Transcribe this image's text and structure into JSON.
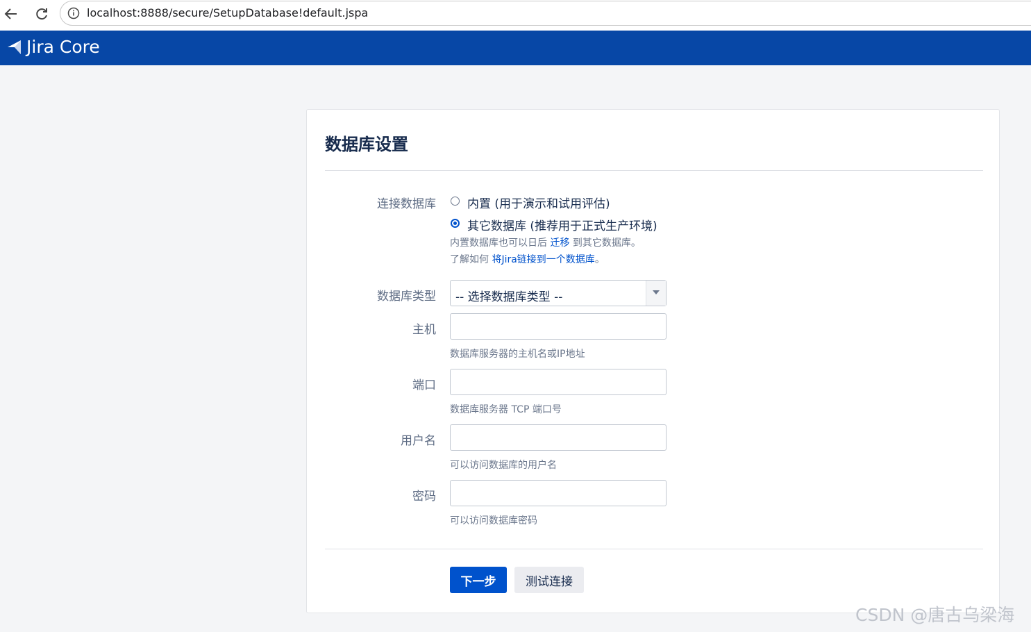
{
  "browser": {
    "url": "localhost:8888/secure/SetupDatabase!default.jspa"
  },
  "header": {
    "product_name": "Jira Core",
    "brand_color": "#0747a6"
  },
  "page": {
    "title": "数据库设置"
  },
  "form": {
    "connection": {
      "label": "连接数据库",
      "options": [
        {
          "label": "内置 (用于演示和试用评估)",
          "checked": false
        },
        {
          "label": "其它数据库 (推荐用于正式生产环境)",
          "checked": true
        }
      ],
      "help_line1_prefix": "内置数据库也可以日后 ",
      "help_line1_link": "迁移",
      "help_line1_suffix": " 到其它数据库。",
      "help_line2_prefix": "了解如何 ",
      "help_line2_link": "将Jira链接到一个数据库",
      "help_line2_suffix": "。"
    },
    "db_type": {
      "label": "数据库类型",
      "value": "-- 选择数据库类型 --"
    },
    "host": {
      "label": "主机",
      "value": "",
      "help": "数据库服务器的主机名或IP地址"
    },
    "port": {
      "label": "端口",
      "value": "",
      "help": "数据库服务器 TCP 端口号"
    },
    "username": {
      "label": "用户名",
      "value": "",
      "help": "可以访问数据库的用户名"
    },
    "password": {
      "label": "密码",
      "value": "",
      "help": "可以访问数据库密码"
    }
  },
  "buttons": {
    "next": "下一步",
    "test": "测试连接"
  },
  "watermark": "CSDN @唐古乌梁海",
  "colors": {
    "primary": "#0052cc",
    "link": "#0052cc",
    "background": "#f4f5f7"
  }
}
